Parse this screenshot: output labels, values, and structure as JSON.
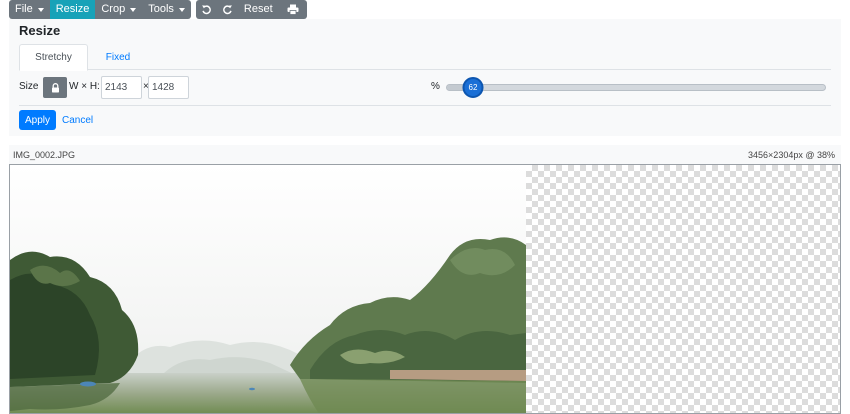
{
  "toolbar": {
    "file_label": "File",
    "resize_label": "Resize",
    "crop_label": "Crop",
    "tools_label": "Tools",
    "undo_icon": "undo-icon",
    "redo_icon": "redo-icon",
    "reset_label": "Reset",
    "print_icon": "print-icon",
    "active_color": "#17a2b8",
    "button_color": "#6c757d"
  },
  "resize_panel": {
    "title": "Resize",
    "tabs": [
      {
        "label": "Stretchy",
        "active": true
      },
      {
        "label": "Fixed",
        "active": false
      }
    ],
    "size_label": "Size",
    "lock_icon": "lock-icon",
    "wh_label": "W × H:",
    "width_value": "2143",
    "times_symbol": "×",
    "height_value": "1428",
    "percent_label": "%",
    "slider_value": "62",
    "slider_fraction": 0.62,
    "apply_label": "Apply",
    "cancel_label": "Cancel",
    "primary_color": "#007bff"
  },
  "image_info": {
    "filename": "IMG_0002.JPG",
    "dimensions": "3456×2304px @  38%"
  }
}
